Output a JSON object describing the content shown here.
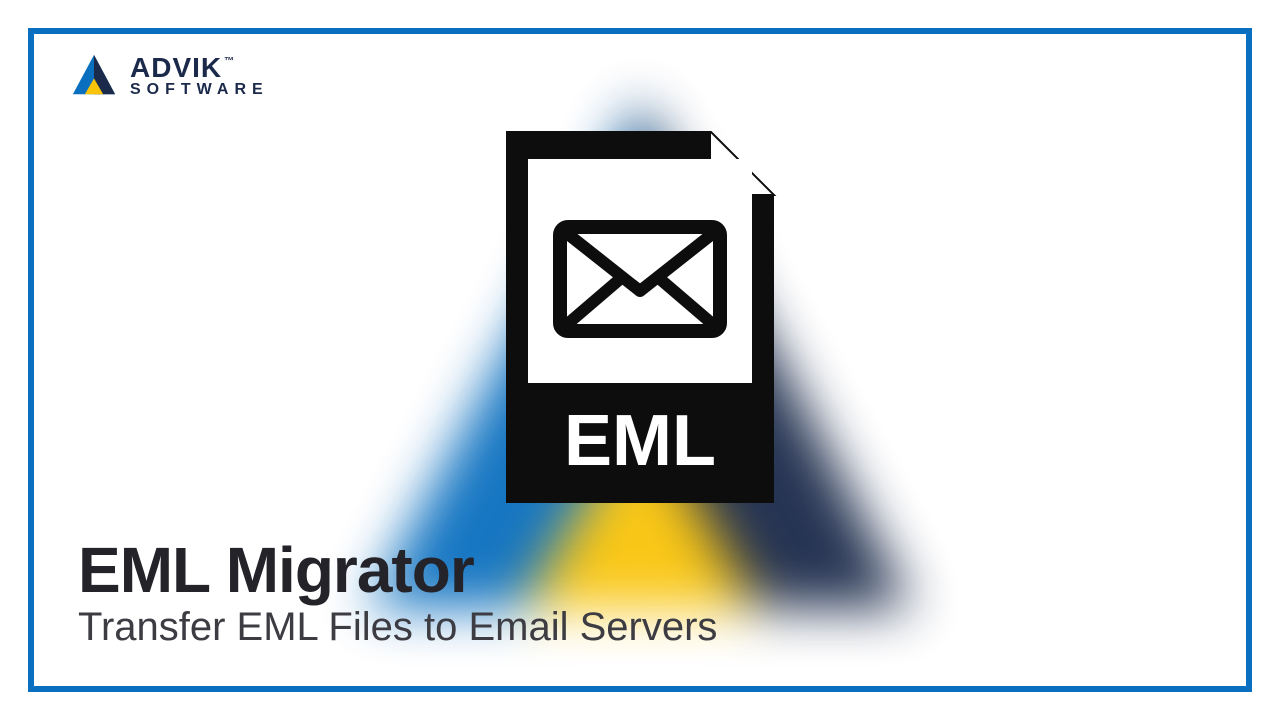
{
  "brand": {
    "name": "ADVIK",
    "tagline": "SOFTWARE",
    "trademark": "™",
    "colors": {
      "blue": "#0a6fbf",
      "dark": "#1b2a4a",
      "yellow": "#f9c40a"
    }
  },
  "file_icon": {
    "label": "EML",
    "semantic": "eml-file-icon"
  },
  "headline": {
    "title": "EML Migrator",
    "subtitle": "Transfer EML Files to Email Servers"
  }
}
